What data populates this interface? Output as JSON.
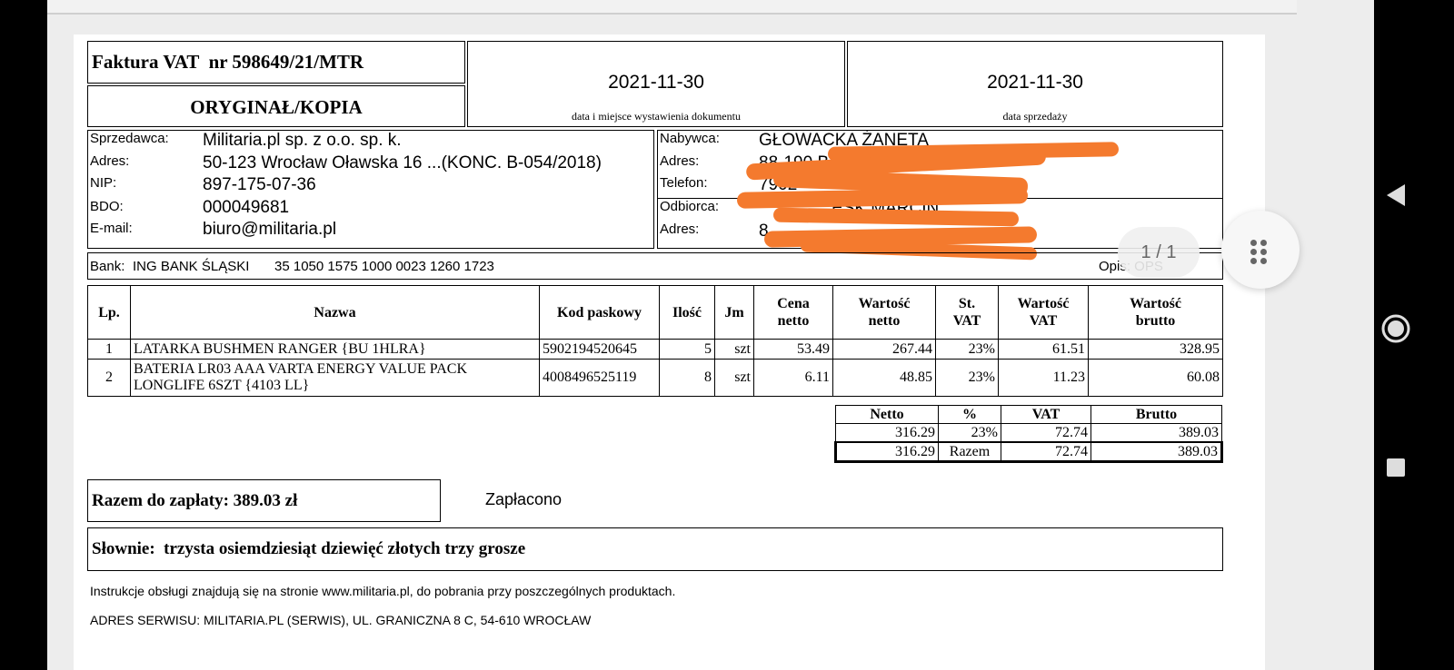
{
  "invoice": {
    "title": "Faktura VAT  nr 598649/21/MTR",
    "copy_label": "ORYGINAŁ/KOPIA",
    "issue_date": "2021-11-30",
    "issue_caption": "data i miejsce wystawienia dokumentu",
    "sale_date": "2021-11-30",
    "sale_caption": "data sprzedaży"
  },
  "seller": {
    "labels": [
      "Sprzedawca:",
      "Adres:",
      "NIP:",
      "BDO:",
      "E-mail:"
    ],
    "values": [
      "Militaria.pl sp. z o.o. sp. k.",
      "50-123 Wrocław Oławska 16 ...(KONC. B-054/2018)",
      "897-175-07-36",
      "000049681",
      "biuro@militaria.pl"
    ]
  },
  "buyer": {
    "labels": [
      "Nabywca:",
      "Adres:",
      "Telefon:",
      "Odbiorca:",
      "Adres:"
    ],
    "values": [
      "GŁOWACKA ŻANETA",
      "88-190 BARCIN, B",
      "7902",
      "ESK MARCIN",
      "8"
    ],
    "redaction_color": "#f47a2e"
  },
  "bank": {
    "label": "Bank:",
    "name": "ING BANK ŚLĄSKI",
    "account": "35 1050 1575 1000 0023 1260 1723",
    "opis": "Opis: OPS"
  },
  "items": {
    "headers": {
      "lp": "Lp.",
      "name": "Nazwa",
      "code": "Kod paskowy",
      "qty": "Ilość",
      "unit": "Jm",
      "price_a": "Cena",
      "price_b": "netto",
      "net_a": "Wartość",
      "net_b": "netto",
      "rate_a": "St.",
      "rate_b": "VAT",
      "vat_a": "Wartość",
      "vat_b": "VAT",
      "gross_a": "Wartość",
      "gross_b": "brutto"
    },
    "rows": [
      {
        "lp": "1",
        "name_a": "LATARKA BUSHMEN RANGER {BU 1HLRA}",
        "name_b": "",
        "code": "5902194520645",
        "qty": "5",
        "unit": "szt",
        "price": "53.49",
        "net": "267.44",
        "rate": "23%",
        "vat": "61.51",
        "gross": "328.95"
      },
      {
        "lp": "2",
        "name_a": "BATERIA LR03 AAA VARTA ENERGY VALUE PACK",
        "name_b": "LONGLIFE 6SZT {4103 LL}",
        "code": "4008496525119",
        "qty": "8",
        "unit": "szt",
        "price": "6.11",
        "net": "48.85",
        "rate": "23%",
        "vat": "11.23",
        "gross": "60.08"
      }
    ]
  },
  "summary": {
    "headers": {
      "net": "Netto",
      "pct": "%",
      "vat": "VAT",
      "gross": "Brutto"
    },
    "row": {
      "net": "316.29",
      "pct": "23%",
      "vat": "72.74",
      "gross": "389.03"
    },
    "total": {
      "net": "316.29",
      "label": "Razem",
      "vat": "72.74",
      "gross": "389.03"
    }
  },
  "payment": {
    "total": "Razem do zapłaty: 389.03 zł",
    "status": "Zapłacono",
    "words": "Słownie:  trzysta osiemdziesiąt dziewięć złotych trzy grosze"
  },
  "footer": {
    "instructions": "Instrukcje obsługi znajdują się na stronie www.militaria.pl, do pobrania przy poszczególnych produktach.",
    "service": "ADRES SERWISU: MILITARIA.PL (SERWIS), UL. GRANICZNA 8 C, 54-610 WROCŁAW"
  },
  "viewer": {
    "page_indicator": "1 / 1",
    "fab_icon": "grid-dots-icon"
  },
  "navigation": {
    "back_icon": "triangle-back-icon",
    "home_icon": "circle-home-icon",
    "recents_icon": "square-recents-icon"
  }
}
